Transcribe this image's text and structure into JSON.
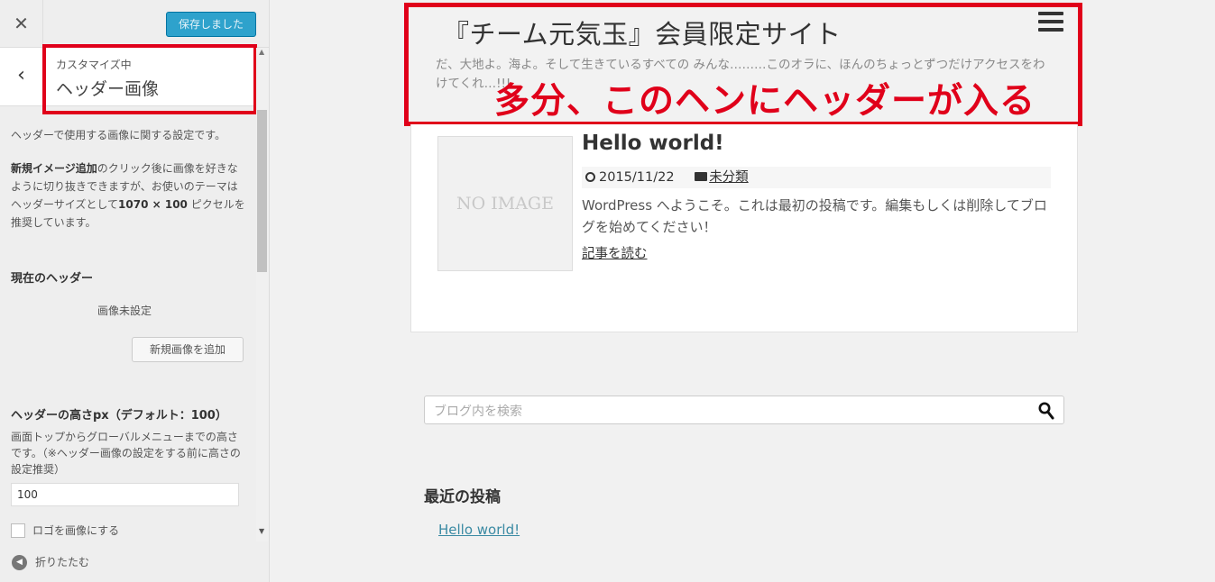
{
  "sidebar": {
    "close_glyph": "✕",
    "save_label": "保存しました",
    "back_glyph": "‹",
    "section_sub": "カスタマイズ中",
    "section_title": "ヘッダー画像",
    "desc": "ヘッダーで使用する画像に関する設定です。",
    "instructions": {
      "strong": "新規イメージ追加",
      "rest": "のクリック後に画像を好きなように切り抜きできますが、お使いのテーマはヘッダーサイズとして",
      "size": "1070 × 100",
      "tail": " ピクセルを推奨しています。"
    },
    "current_header_label": "現在のヘッダー",
    "no_image_label": "画像未設定",
    "add_image_button": "新規画像を追加",
    "height_label": "ヘッダーの高さpx（デフォルト：100）",
    "height_desc": "画面トップからグローバルメニューまでの高さです。（※ヘッダー画像の設定をする前に高さの設定推奨）",
    "height_value": "100",
    "logo_checkbox_label": "ロゴを画像にする",
    "collapse_label": "折りたたむ"
  },
  "preview": {
    "site_title": "『チーム元気玉』会員限定サイト",
    "site_desc": "だ、大地よ。海よ。そして生きているすべての みんな………このオラに、ほんのちょっとずつだけアクセスをわけてくれ…!!!",
    "annotation": "多分、このヘンにヘッダーが入る",
    "post": {
      "thumb_text": "NO IMAGE",
      "title": "Hello world!",
      "date": "2015/11/22",
      "category": "未分類",
      "excerpt": "WordPress へようこそ。これは最初の投稿です。編集もしくは削除してブログを始めてください！",
      "read_more": "記事を読む"
    },
    "search_placeholder": "ブログ内を検索",
    "recent_heading": "最近の投稿",
    "recent_items": [
      "Hello world!"
    ]
  },
  "colors": {
    "save_button": "#2ea2cc",
    "highlight_red": "#e0001a",
    "link": "#3a8aa3"
  }
}
